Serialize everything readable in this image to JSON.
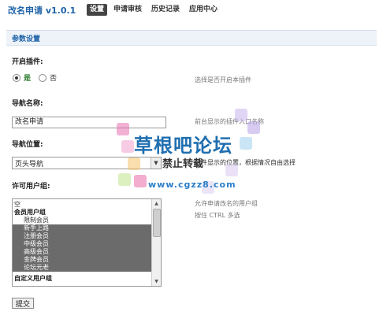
{
  "app_title": "改名申请 v1.0.1",
  "nav": [
    "设置",
    "申请审核",
    "历史记录",
    "应用中心"
  ],
  "section_title": "参数设置",
  "enable": {
    "label": "开启插件:",
    "options": [
      "是",
      "否"
    ],
    "selected": "是",
    "hint": "选择是否开启本插件"
  },
  "nav_name": {
    "label": "导航名称:",
    "value": "改名申请",
    "hint": "前台显示的插件入口名称"
  },
  "nav_position": {
    "label": "导航位置:",
    "value": "页头导航",
    "hint": "插件显示的位置，根据情况自由选择"
  },
  "allowed_groups": {
    "label": "许可用户组:",
    "hint1": "允许申请改名的用户组",
    "hint2": "按住 CTRL 多选",
    "options": [
      {
        "text": "空",
        "type": "plain",
        "selected": false
      },
      {
        "text": "会员用户组",
        "type": "group",
        "selected": false
      },
      {
        "text": "限制会员",
        "type": "indent",
        "selected": false
      },
      {
        "text": "新手上路",
        "type": "indent",
        "selected": true
      },
      {
        "text": "注册会员",
        "type": "indent",
        "selected": true
      },
      {
        "text": "中级会员",
        "type": "indent",
        "selected": true
      },
      {
        "text": "高级会员",
        "type": "indent",
        "selected": true
      },
      {
        "text": "金牌会员",
        "type": "indent",
        "selected": true
      },
      {
        "text": "论坛元老",
        "type": "indent",
        "selected": true
      },
      {
        "text": "自定义用户组",
        "type": "group",
        "selected": false
      }
    ]
  },
  "submit_label": "提交",
  "watermark": {
    "line1": "草根吧论坛",
    "line2": "禁止转载",
    "line3": "www.cgzz8.com"
  }
}
